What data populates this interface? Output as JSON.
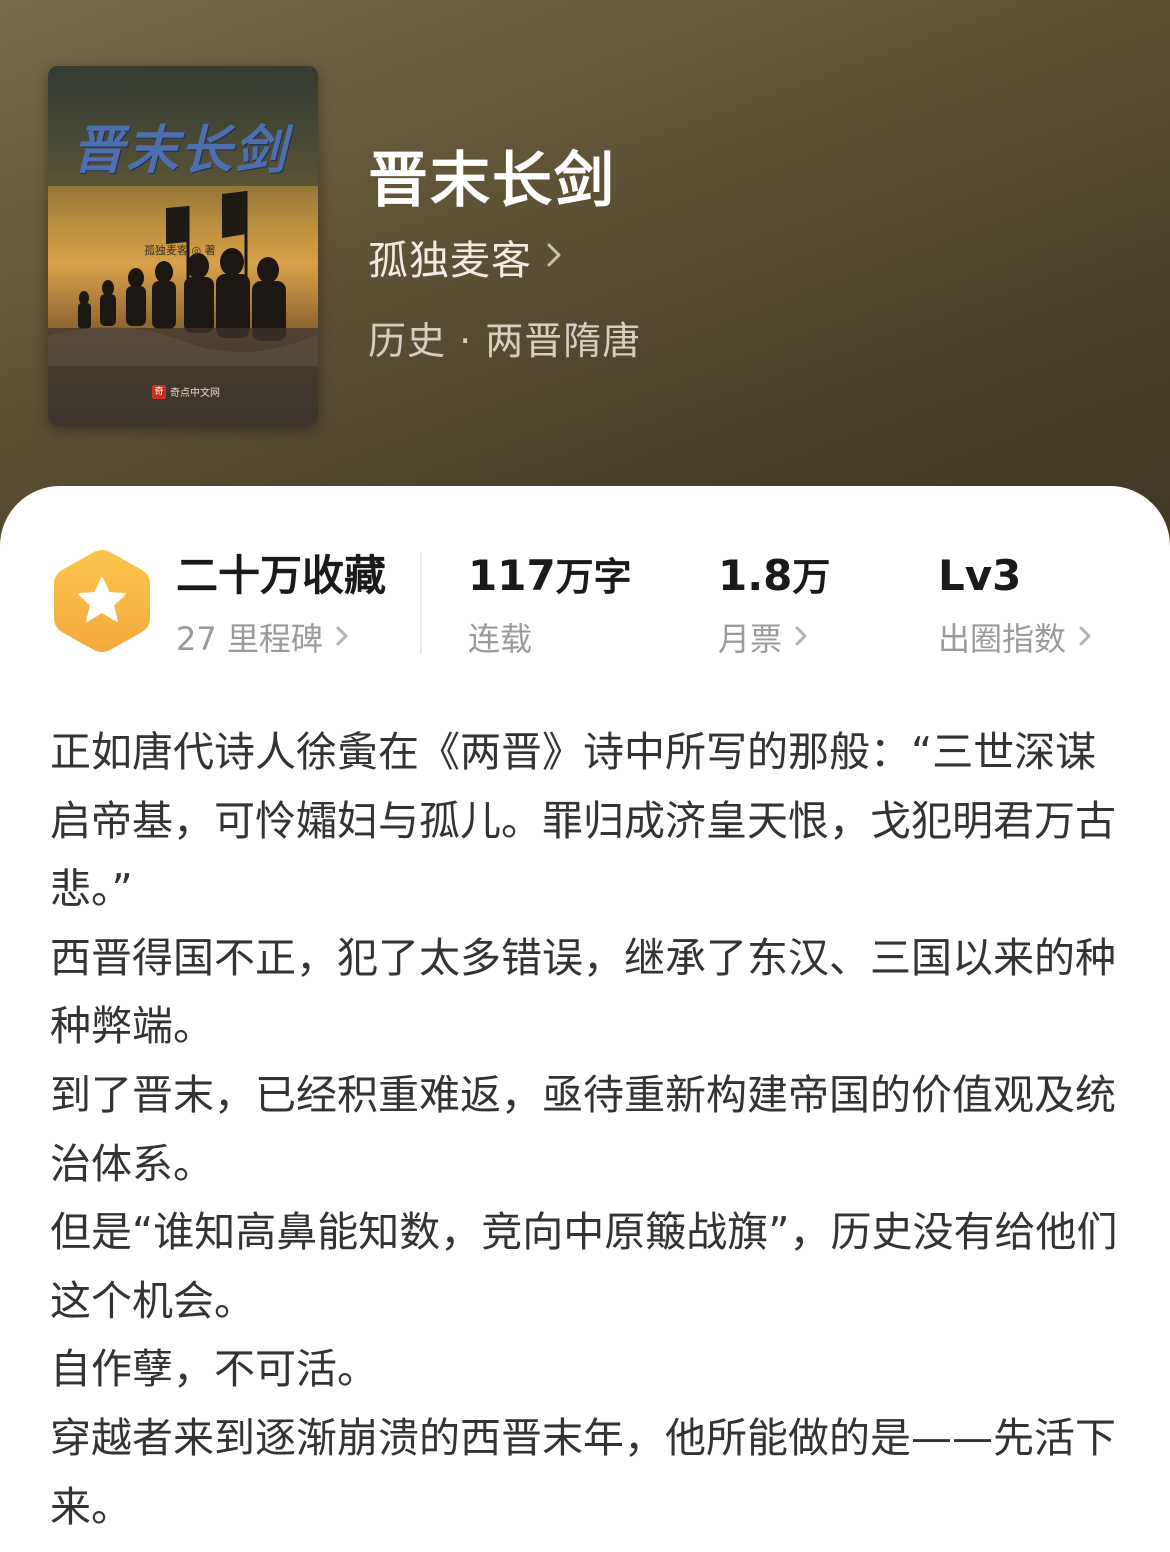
{
  "book": {
    "title": "晋末长剑",
    "author": "孤独麦客",
    "genre": "历史 · 两晋隋唐",
    "cover": {
      "title": "晋末长剑",
      "author": "孤独麦客 ◎ 著",
      "publisher": "奇点中文网"
    }
  },
  "stats": {
    "collection": {
      "value": "二十万收藏",
      "label": "27 里程碑"
    },
    "words": {
      "value_num": "117",
      "value_unit": "万字",
      "label": "连载"
    },
    "monthly": {
      "value_num": "1.8",
      "value_unit": "万",
      "label": "月票"
    },
    "level": {
      "value": "Lv3",
      "label": "出圈指数"
    }
  },
  "synopsis": [
    "正如唐代诗人徐夤在《两晋》诗中所写的那般：“三世深谋启帝基，可怜孀妇与孤儿。罪归成济皇天恨，戈犯明君万古悲。”",
    "西晋得国不正，犯了太多错误，继承了东汉、三国以来的种种弊端。",
    "到了晋末，已经积重难返，亟待重新构建帝国的价值观及统治体系。",
    "但是“谁知高鼻能知数，竞向中原簸战旗”，历史没有给他们这个机会。",
    "自作孽，不可活。",
    "穿越者来到逐渐崩溃的西晋末年，他所能做的是——先活下来。"
  ],
  "colors": {
    "header_gradient_start": "#776a4a",
    "header_gradient_end": "#3f3724",
    "badge_orange": "#f5b43c",
    "text_primary": "#1a1a1a",
    "text_secondary": "#9b9b9b"
  },
  "icons": [
    "chevron-right-icon",
    "star-hexagon-badge-icon"
  ]
}
